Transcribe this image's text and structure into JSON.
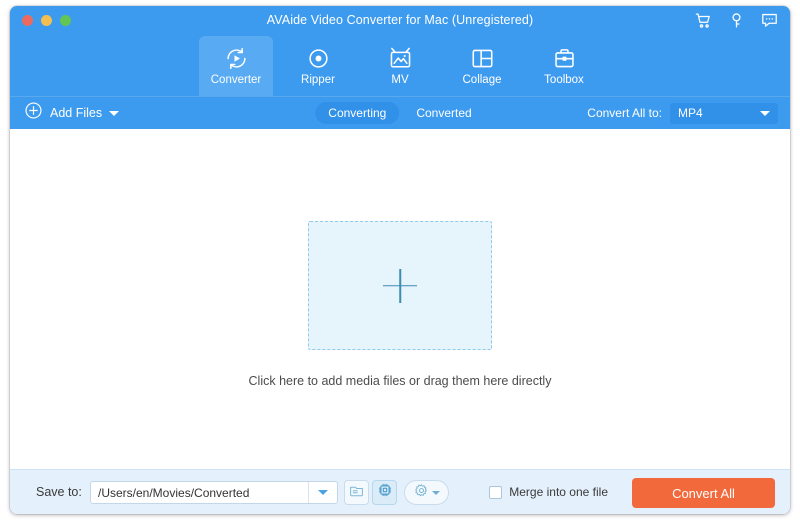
{
  "window": {
    "title": "AVAide Video Converter for Mac (Unregistered)",
    "traffic_lights": [
      {
        "name": "close",
        "color": "#ec6a5f"
      },
      {
        "name": "minimize",
        "color": "#f3bf50"
      },
      {
        "name": "zoom",
        "color": "#62c554"
      }
    ],
    "title_actions": [
      {
        "icon": "cart-icon",
        "label": "Buy"
      },
      {
        "icon": "key-icon",
        "label": "Register"
      },
      {
        "icon": "chat-icon",
        "label": "Feedback"
      }
    ]
  },
  "nav": {
    "tabs": [
      {
        "label": "Converter",
        "icon": "converter-icon",
        "active": true
      },
      {
        "label": "Ripper",
        "icon": "ripper-icon",
        "active": false
      },
      {
        "label": "MV",
        "icon": "mv-icon",
        "active": false
      },
      {
        "label": "Collage",
        "icon": "collage-icon",
        "active": false
      },
      {
        "label": "Toolbox",
        "icon": "toolbox-icon",
        "active": false
      }
    ]
  },
  "toolbar": {
    "add_files_label": "Add Files",
    "add_files_icon": "plus-circle-icon",
    "segments": [
      {
        "label": "Converting",
        "active": true
      },
      {
        "label": "Converted",
        "active": false
      }
    ],
    "convert_all_to_label": "Convert All to:",
    "convert_all_to_value": "MP4"
  },
  "canvas": {
    "dropzone_icon": "plus-icon",
    "hint": "Click here to add media files or drag them here directly"
  },
  "bottom": {
    "save_to_label": "Save to:",
    "save_to_path": "/Users/en/Movies/Converted",
    "save_to_placeholder": "/Users/en/Movies/Converted",
    "folder_icon": "folder-icon",
    "hardware_accel_icon": "cpu-chip-icon",
    "hardware_accel_state": "ON",
    "settings_icon": "gear-icon",
    "merge_label": "Merge into one file",
    "merge_checked": false,
    "convert_all_label": "Convert All"
  },
  "colors": {
    "brand_blue": "#3d9bef",
    "tab_active": "#58aaf2",
    "accent_orange": "#f2693c",
    "bottom_bar": "#e4f0fb",
    "dropzone_fill": "#e6f4fc",
    "dropzone_border": "#8fcbe8"
  }
}
